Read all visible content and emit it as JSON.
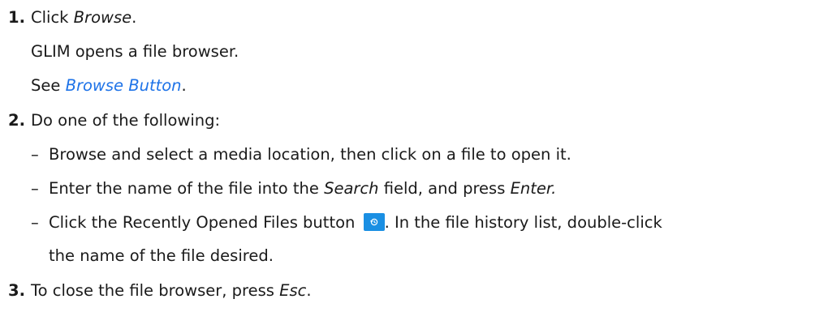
{
  "steps": [
    {
      "number": "1.",
      "action_prefix": "Click ",
      "action_em": "Browse",
      "action_suffix": ".",
      "result": "GLIM opens a file browser.",
      "see_prefix": "See ",
      "see_link": "Browse Button",
      "see_suffix": "."
    },
    {
      "number": "2.",
      "text": "Do one of the following:",
      "bullets": [
        {
          "dash": "–",
          "text": "Browse and select a media location, then click on a file to open it."
        },
        {
          "dash": "–",
          "text_a": "Enter the name of the file into the ",
          "em_a": "Search",
          "text_b": " field, and press ",
          "em_b": "Enter.",
          "text_c": ""
        },
        {
          "dash": "–",
          "text_a": "Click the Recently Opened Files button ",
          "icon": "history-icon",
          "text_b": ". In the file history list, double-click",
          "continuation": "the name of the file desired."
        }
      ]
    },
    {
      "number": "3.",
      "text_prefix": "To close the file browser, press ",
      "em": "Esc",
      "text_suffix": "."
    }
  ],
  "colors": {
    "link": "#1e73e8",
    "button": "#1a8fe3"
  }
}
